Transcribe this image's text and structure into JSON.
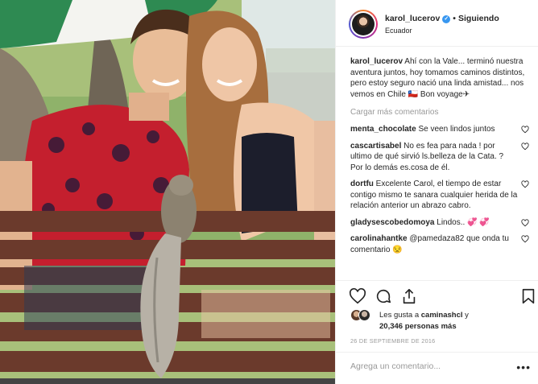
{
  "post": {
    "username": "karol_lucerov",
    "verified": true,
    "separator": "•",
    "follow_status": "Siguiendo",
    "location": "Ecuador"
  },
  "caption": {
    "username": "karol_lucerov",
    "text": "Ahí con la Vale... terminó nuestra aventura juntos, hoy tomamos caminos distintos, pero estoy seguro nació una linda amistad... nos vemos en Chile 🇨🇱 Bon voyage✈"
  },
  "load_more_label": "Cargar más comentarios",
  "comments": [
    {
      "username": "menta_chocolate",
      "text": "Se veen lindos juntos"
    },
    {
      "username": "cascartisabel",
      "text": "No es fea para nada ! por ultimo de qué sirvió ls.belleza de la Cata. ? Por lo demás es.cosa de él."
    },
    {
      "username": "dortfu",
      "text": "Excelente Carol, el tiempo de estar contigo mismo te sanara cualquier herida de la relación anterior un abrazo cabro."
    },
    {
      "username": "gladysescobedomoya",
      "text": "Lindos.. 💞 💞"
    },
    {
      "username": "carolinahantke",
      "text": "@pamedaza82 que onda tu comentario 😒"
    }
  ],
  "icons": {
    "like": "heart-icon",
    "comment": "comment-icon",
    "share": "share-icon",
    "save": "bookmark-icon"
  },
  "likes": {
    "prefix": "Les gusta a",
    "user": "caminashcl",
    "middle": "y",
    "count": "20,346",
    "suffix": "personas más"
  },
  "date": "26 DE SEPTIEMBRE DE 2016",
  "add_comment": {
    "placeholder": "Agrega un comentario...",
    "more_label": "•••"
  }
}
